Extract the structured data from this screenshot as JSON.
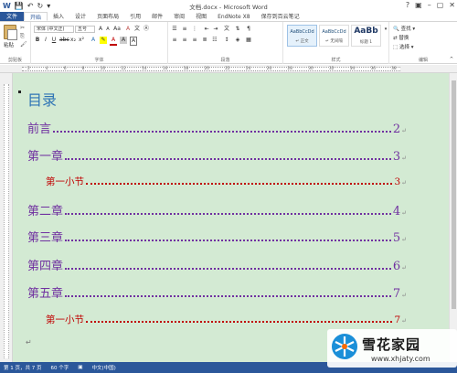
{
  "window": {
    "title": "文档.docx - Microsoft Word",
    "controls": [
      "?",
      "▣",
      "–",
      "▢",
      "✕"
    ]
  },
  "tabs": [
    "文件",
    "开始",
    "插入",
    "设计",
    "页面布局",
    "引用",
    "邮件",
    "审阅",
    "视图",
    "EndNote X8",
    "保存到百云笔记"
  ],
  "active_tab": "开始",
  "ribbon": {
    "clipboard": {
      "paste_label": "粘贴",
      "group_label": "剪贴板"
    },
    "font": {
      "font_name": "宋体 (中文正)",
      "font_size": "五号",
      "group_label": "字体",
      "bold": "B",
      "italic": "I",
      "underline": "U"
    },
    "paragraph": {
      "group_label": "段落"
    },
    "styles": {
      "group_label": "样式",
      "items": [
        {
          "sample": "AaBbCcDd",
          "name": "↵ 正文"
        },
        {
          "sample": "AaBbCcDd",
          "name": "↵ 无间隔"
        },
        {
          "sample": "AaBb",
          "name": "标题 1"
        }
      ]
    },
    "editing": {
      "group_label": "编辑",
      "find": "查找 ▾",
      "replace": "替换",
      "select": "选择 ▾"
    }
  },
  "ruler": {
    "numbers": [
      "2",
      "4",
      "6",
      "8",
      "10",
      "12",
      "14",
      "16",
      "18",
      "20",
      "22",
      "24",
      "26",
      "28",
      "30",
      "32",
      "34",
      "36",
      "38"
    ]
  },
  "document": {
    "toc_title": "目录",
    "entries": [
      {
        "text": "前言",
        "page": "2",
        "level": 1
      },
      {
        "text": "第一章",
        "page": "3",
        "level": 1
      },
      {
        "text": "第一小节",
        "page": "3",
        "level": 2
      },
      {
        "text": "第二章",
        "page": "4",
        "level": 1
      },
      {
        "text": "第三章",
        "page": "5",
        "level": 1
      },
      {
        "text": "第四章",
        "page": "6",
        "level": 1
      },
      {
        "text": "第五章",
        "page": "7",
        "level": 1
      },
      {
        "text": "第一小节",
        "page": "7",
        "level": 2
      }
    ],
    "paragraph_mark": "↵",
    "background_color": "#d3ead3",
    "level1_color": "#7030a0",
    "level2_color": "#c00000",
    "title_color": "#2e74b5"
  },
  "status": {
    "page": "第 1 页，共 7 页",
    "words": "60 个字",
    "language": "中文(中国)"
  },
  "watermark": {
    "name": "雪花家园",
    "url": "www.xhjaty.com"
  },
  "colors": {
    "accent": "#2b579a"
  }
}
